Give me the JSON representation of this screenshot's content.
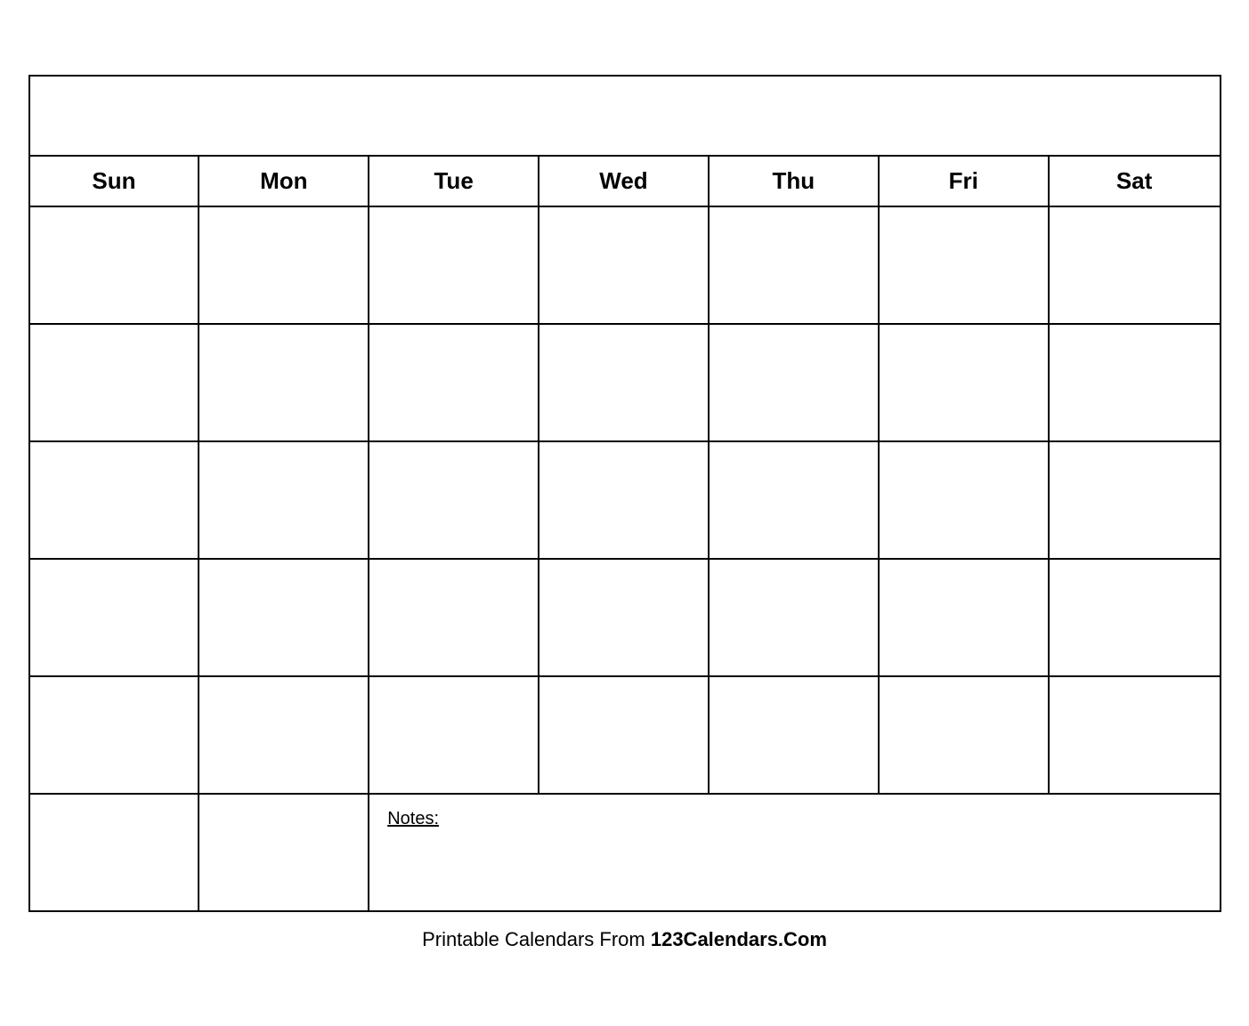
{
  "calendar": {
    "title": "",
    "days": [
      "Sun",
      "Mon",
      "Tue",
      "Wed",
      "Thu",
      "Fri",
      "Sat"
    ],
    "rows": 5,
    "notes_label": "Notes:"
  },
  "footer": {
    "prefix": "Printable Calendars From ",
    "brand": "123Calendars.Com"
  }
}
